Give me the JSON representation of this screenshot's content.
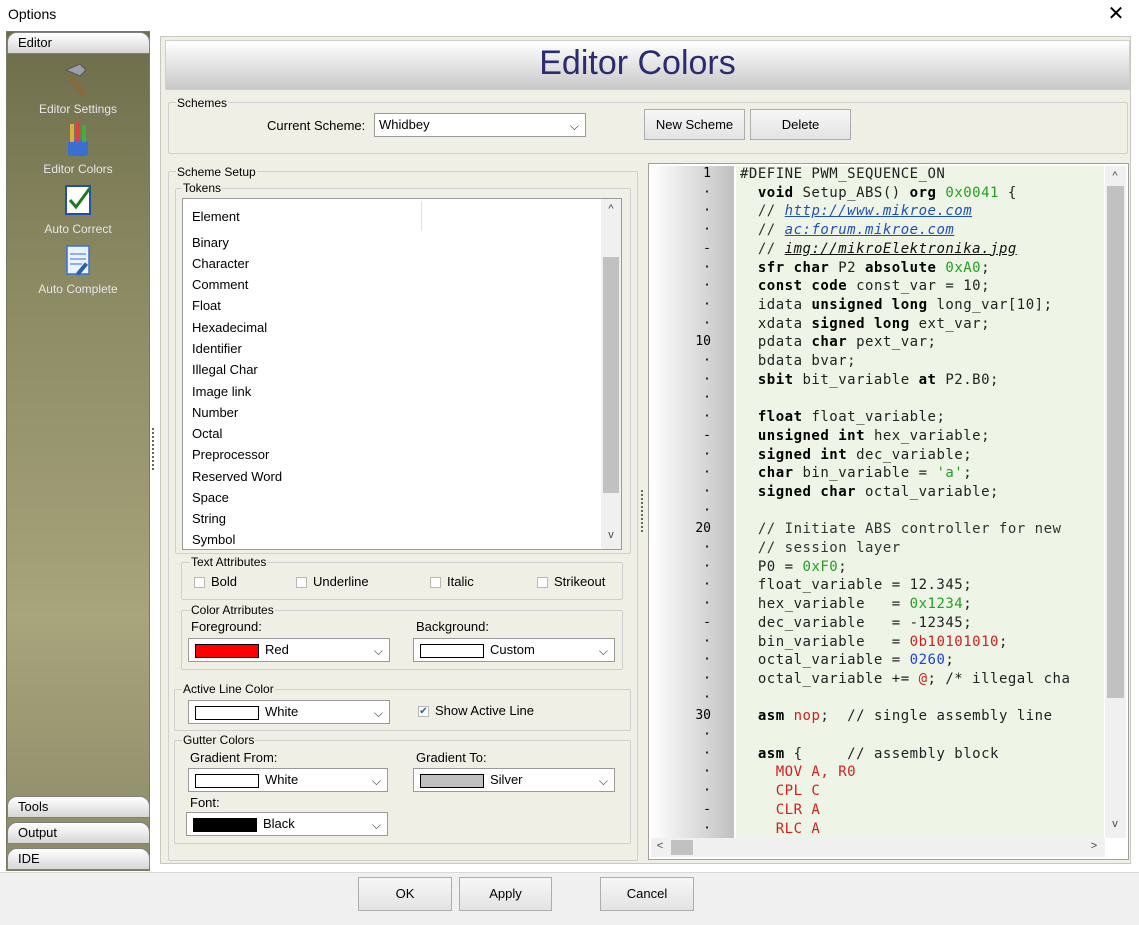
{
  "window": {
    "title": "Options",
    "close_glyph": "✕"
  },
  "sidebar": {
    "top_tab": "Editor",
    "items": [
      {
        "label": "Editor Settings",
        "icon": "hammer-icon"
      },
      {
        "label": "Editor Colors",
        "icon": "paint-brushes-icon"
      },
      {
        "label": "Auto Correct",
        "icon": "checkmark-document-icon"
      },
      {
        "label": "Auto Complete",
        "icon": "notepad-pencil-icon"
      }
    ],
    "bottom_tabs": [
      "Tools",
      "Output",
      "IDE"
    ]
  },
  "header": {
    "title": "Editor Colors"
  },
  "schemes": {
    "group_label": "Schemes",
    "current_label": "Current Scheme:",
    "current_value": "Whidbey",
    "new_button": "New Scheme",
    "delete_button": "Delete"
  },
  "scheme_setup": {
    "group_label": "Scheme Setup",
    "tokens_label": "Tokens",
    "tokens_header": "Element",
    "tokens": [
      "Binary",
      "Character",
      "Comment",
      "Float",
      "Hexadecimal",
      "Identifier",
      "Illegal Char",
      "Image link",
      "Number",
      "Octal",
      "Preprocessor",
      "Reserved Word",
      "Space",
      "String",
      "Symbol"
    ],
    "text_attributes": {
      "label": "Text Attributes",
      "bold": "Bold",
      "underline": "Underline",
      "italic": "Italic",
      "strikeout": "Strikeout"
    },
    "color_attributes": {
      "label": "Color Atrributes",
      "foreground_label": "Foreground:",
      "foreground_value": "Red",
      "foreground_color": "#ff0000",
      "background_label": "Background:",
      "background_value": "Custom",
      "background_color": "#ffffff"
    },
    "active_line": {
      "label": "Active Line Color",
      "value": "White",
      "color": "#ffffff",
      "show_label": "Show Active Line",
      "show_checked": true,
      "check_glyph": "✔"
    },
    "gutter": {
      "label": "Gutter Colors",
      "from_label": "Gradient From:",
      "from_value": "White",
      "from_color": "#ffffff",
      "to_label": "Gradient To:",
      "to_value": "Silver",
      "to_color": "#c0c0c0",
      "font_label": "Font:",
      "font_value": "Black",
      "font_color": "#000000"
    }
  },
  "preview": {
    "gutter": [
      "1",
      "·",
      "·",
      "·",
      "-",
      "·",
      "·",
      "·",
      "·",
      "10",
      "·",
      "·",
      "·",
      "·",
      "-",
      "·",
      "·",
      "·",
      "·",
      "20",
      "·",
      "·",
      "·",
      "·",
      "-",
      "·",
      "·",
      "·",
      "·",
      "30",
      "·",
      "·",
      "·",
      "·",
      "-",
      "·"
    ],
    "lines": [
      [
        [
          "",
          "#DEFINE PWM_SEQUENCE_ON"
        ]
      ],
      [
        [
          "kw",
          "  void"
        ],
        [
          "",
          " Setup_ABS() "
        ],
        [
          "kw",
          "org"
        ],
        [
          "",
          " "
        ],
        [
          "num",
          "0x0041"
        ],
        [
          "",
          " {"
        ]
      ],
      [
        [
          "cmt",
          "  // "
        ],
        [
          "lnk",
          "http://www.mikroe.com"
        ]
      ],
      [
        [
          "cmt",
          "  // "
        ],
        [
          "lnk",
          "ac:forum.mikroe.com"
        ]
      ],
      [
        [
          "cmt",
          "  // "
        ],
        [
          "img",
          "img://mikroElektronika.jpg"
        ]
      ],
      [
        [
          "kw",
          "  sfr char"
        ],
        [
          "",
          " P2 "
        ],
        [
          "kw",
          "absolute"
        ],
        [
          "",
          " "
        ],
        [
          "num",
          "0xA0"
        ],
        [
          "",
          ";"
        ]
      ],
      [
        [
          "kw",
          "  const code"
        ],
        [
          "",
          " const_var = 10;"
        ]
      ],
      [
        [
          "",
          "  idata "
        ],
        [
          "kw",
          "unsigned long"
        ],
        [
          "",
          " long_var[10];"
        ]
      ],
      [
        [
          "",
          "  xdata "
        ],
        [
          "kw",
          "signed long"
        ],
        [
          "",
          " ext_var;"
        ]
      ],
      [
        [
          "",
          "  pdata "
        ],
        [
          "kw",
          "char"
        ],
        [
          "",
          " pext_var;"
        ]
      ],
      [
        [
          "",
          "  bdata bvar;"
        ]
      ],
      [
        [
          "kw",
          "  sbit"
        ],
        [
          "",
          " bit_variable "
        ],
        [
          "kw",
          "at"
        ],
        [
          "",
          " P2.B0;"
        ]
      ],
      [
        [
          "",
          ""
        ]
      ],
      [
        [
          "kw",
          "  float"
        ],
        [
          "",
          " float_variable;"
        ]
      ],
      [
        [
          "kw",
          "  unsigned int"
        ],
        [
          "",
          " hex_variable;"
        ]
      ],
      [
        [
          "kw",
          "  signed int"
        ],
        [
          "",
          " dec_variable;"
        ]
      ],
      [
        [
          "kw",
          "  char"
        ],
        [
          "",
          " bin_variable = "
        ],
        [
          "num",
          "'a'"
        ],
        [
          "",
          ";"
        ]
      ],
      [
        [
          "kw",
          "  signed char"
        ],
        [
          "",
          " octal_variable;"
        ]
      ],
      [
        [
          "",
          ""
        ]
      ],
      [
        [
          "cmt",
          "  // Initiate ABS controller for new"
        ]
      ],
      [
        [
          "cmt",
          "  // session layer"
        ]
      ],
      [
        [
          "",
          "  P0 = "
        ],
        [
          "num",
          "0xF0"
        ],
        [
          "",
          ";"
        ]
      ],
      [
        [
          "",
          "  float_variable = 12.345;"
        ]
      ],
      [
        [
          "",
          "  hex_variable   = "
        ],
        [
          "num",
          "0x1234"
        ],
        [
          "",
          ";"
        ]
      ],
      [
        [
          "",
          "  dec_variable   = -12345;"
        ]
      ],
      [
        [
          "",
          "  bin_variable   = "
        ],
        [
          "str",
          "0b10101010"
        ],
        [
          "",
          ";"
        ]
      ],
      [
        [
          "",
          "  octal_variable = "
        ],
        [
          "oct",
          "0260"
        ],
        [
          "",
          ";"
        ]
      ],
      [
        [
          "",
          "  octal_variable += "
        ],
        [
          "ill",
          "@"
        ],
        [
          "",
          "; /* illegal cha"
        ]
      ],
      [
        [
          "",
          ""
        ]
      ],
      [
        [
          "kw",
          "  asm"
        ],
        [
          "",
          " "
        ],
        [
          "str",
          "nop"
        ],
        [
          "",
          ";  // single assembly line"
        ]
      ],
      [
        [
          "",
          ""
        ]
      ],
      [
        [
          "kw",
          "  asm"
        ],
        [
          "",
          " {     // assembly block"
        ]
      ],
      [
        [
          "asm",
          "    MOV A, R0"
        ]
      ],
      [
        [
          "asm",
          "    CPL C"
        ]
      ],
      [
        [
          "asm",
          "    CLR A"
        ]
      ],
      [
        [
          "asm",
          "    RLC A"
        ]
      ]
    ]
  },
  "footer": {
    "ok": "OK",
    "apply": "Apply",
    "cancel": "Cancel"
  },
  "scroll_glyphs": {
    "up": "^",
    "down": "v",
    "left": "<",
    "right": ">",
    "combo": "⌵"
  }
}
